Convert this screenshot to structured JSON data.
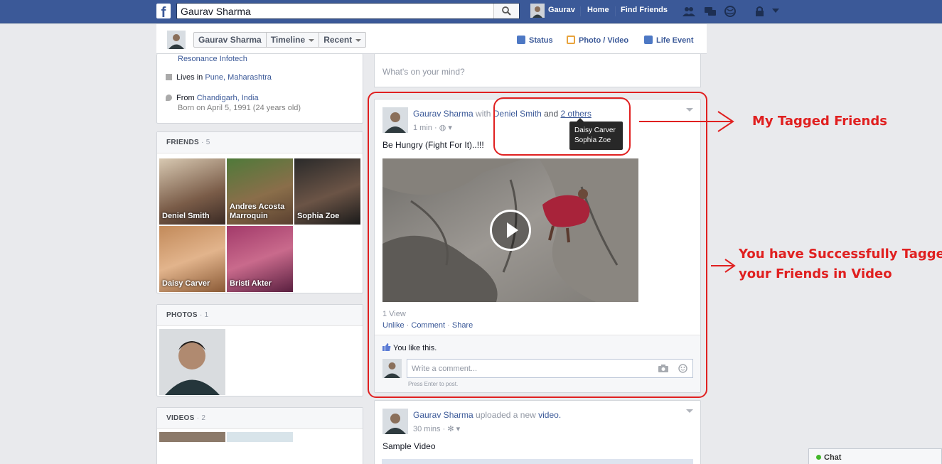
{
  "topbar": {
    "logo": "f",
    "search_value": "Gaurav Sharma",
    "user_name": "Gaurav",
    "home": "Home",
    "find_friends": "Find Friends"
  },
  "subheader": {
    "crumb_name": "Gaurav Sharma",
    "crumb_timeline": "Timeline",
    "crumb_recent": "Recent",
    "status": "Status",
    "photo_video": "Photo / Video",
    "life_event": "Life Event"
  },
  "about": {
    "work": "Resonance Infotech",
    "lives_prefix": "Lives in ",
    "lives_place": "Pune, Maharashtra",
    "from_prefix": "From ",
    "from_place": "Chandigarh, India",
    "born": "Born on April 5, 1991 (24 years old)"
  },
  "friends": {
    "title": "FRIENDS",
    "count": "· 5",
    "items": [
      {
        "name": "Deniel Smith"
      },
      {
        "name": "Andres Acosta Marroquin"
      },
      {
        "name": "Sophia Zoe"
      },
      {
        "name": "Daisy Carver"
      },
      {
        "name": "Bristi Akter"
      }
    ]
  },
  "photos": {
    "title": "PHOTOS",
    "count": "· 1"
  },
  "videos": {
    "title": "VIDEOS",
    "count": "· 2"
  },
  "composer": {
    "placeholder": "What's on your mind?"
  },
  "post1": {
    "author": "Gaurav Sharma",
    "with": "with",
    "tagged": "Deniel Smith",
    "and": "and",
    "others": "2 others",
    "time": "1 min",
    "text": "Be Hungry (Fight For It)..!!!",
    "tooltip": [
      "Daisy Carver",
      "Sophia Zoe"
    ],
    "views": "1 View",
    "actions": [
      "Unlike",
      "Comment",
      "Share"
    ],
    "likes": "You like this.",
    "comment_placeholder": "Write a comment...",
    "press_enter": "Press Enter to post."
  },
  "post2": {
    "author": "Gaurav Sharma",
    "action": "uploaded a new",
    "object": "video.",
    "time": "30 mins",
    "text": "Sample Video"
  },
  "annotations": {
    "tagged_friends": "My Tagged Friends",
    "success_line1": "You have Successfully Tagged",
    "success_line2": "your Friends in Video",
    "color": "#e02020"
  },
  "chat": {
    "label": "Chat"
  },
  "colors": {
    "brand": "#3b5998",
    "page_bg": "#e9eaed"
  }
}
